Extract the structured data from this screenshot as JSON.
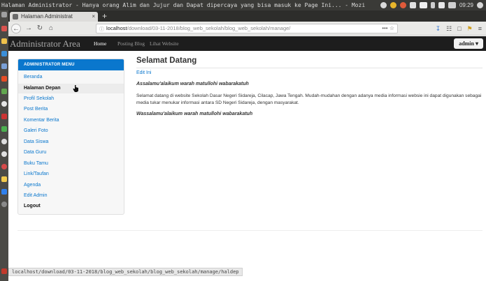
{
  "system": {
    "window_title": "Halaman Administrator - Hanya orang Alim dan Jujur dan Dapat dipercaya yang bisa masuk ke Page Ini... - Mozilla",
    "time": "09:29"
  },
  "browser": {
    "tab_title": "Halaman Administrat",
    "tab_close": "×",
    "new_tab": "+",
    "url_host": "localhost",
    "url_path": "/download/03-11-2018/blog_web_sekolah/blog_web_sekolah/manage/",
    "url_tools": "••• ☆",
    "status_url": "localhost/download/03-11-2018/blog_web_sekolah/blog_web_sekolah/manage/haldep"
  },
  "header": {
    "brand": "Administrator Area",
    "nav": [
      "Home",
      "Posting Blog",
      "Lihat Website"
    ],
    "admin_label": "admin ▾"
  },
  "sidebar": {
    "heading": "ADMINISTRATOR MENU",
    "items": [
      {
        "label": "Beranda"
      },
      {
        "label": "Halaman Depan"
      },
      {
        "label": "Profil Sekolah"
      },
      {
        "label": "Post Berita"
      },
      {
        "label": "Komentar Berita"
      },
      {
        "label": "Galeri Foto"
      },
      {
        "label": "Data Siswa"
      },
      {
        "label": "Data Guru"
      },
      {
        "label": "Buku Tamu"
      },
      {
        "label": "Link/Taufan"
      },
      {
        "label": "Agenda"
      },
      {
        "label": "Edit Admin"
      },
      {
        "label": "Logout"
      }
    ],
    "active_index": 1
  },
  "main": {
    "title": "Selamat Datang",
    "edit_link": "Edit Ini",
    "greeting": "Assalamu'alaikum warah matullohi wabarakatuh",
    "body": "Selamat datang di website Sekolah Dasar Negeri Sidareja, Cilacap, Jawa Tengah. Mudah-mudahan dengan adanya media informasi websie ini dapat digunakan sebagai media tukar menukar informasi antara SD Negeri Sidareja, dengan masyarakat.",
    "closing": "Wassalamu'alaikum warah matullohi wabarakatuh"
  },
  "colors": {
    "accent": "#0a77cd",
    "header_bg": "#1d1d1d",
    "panel_bg": "#3a3a37"
  }
}
